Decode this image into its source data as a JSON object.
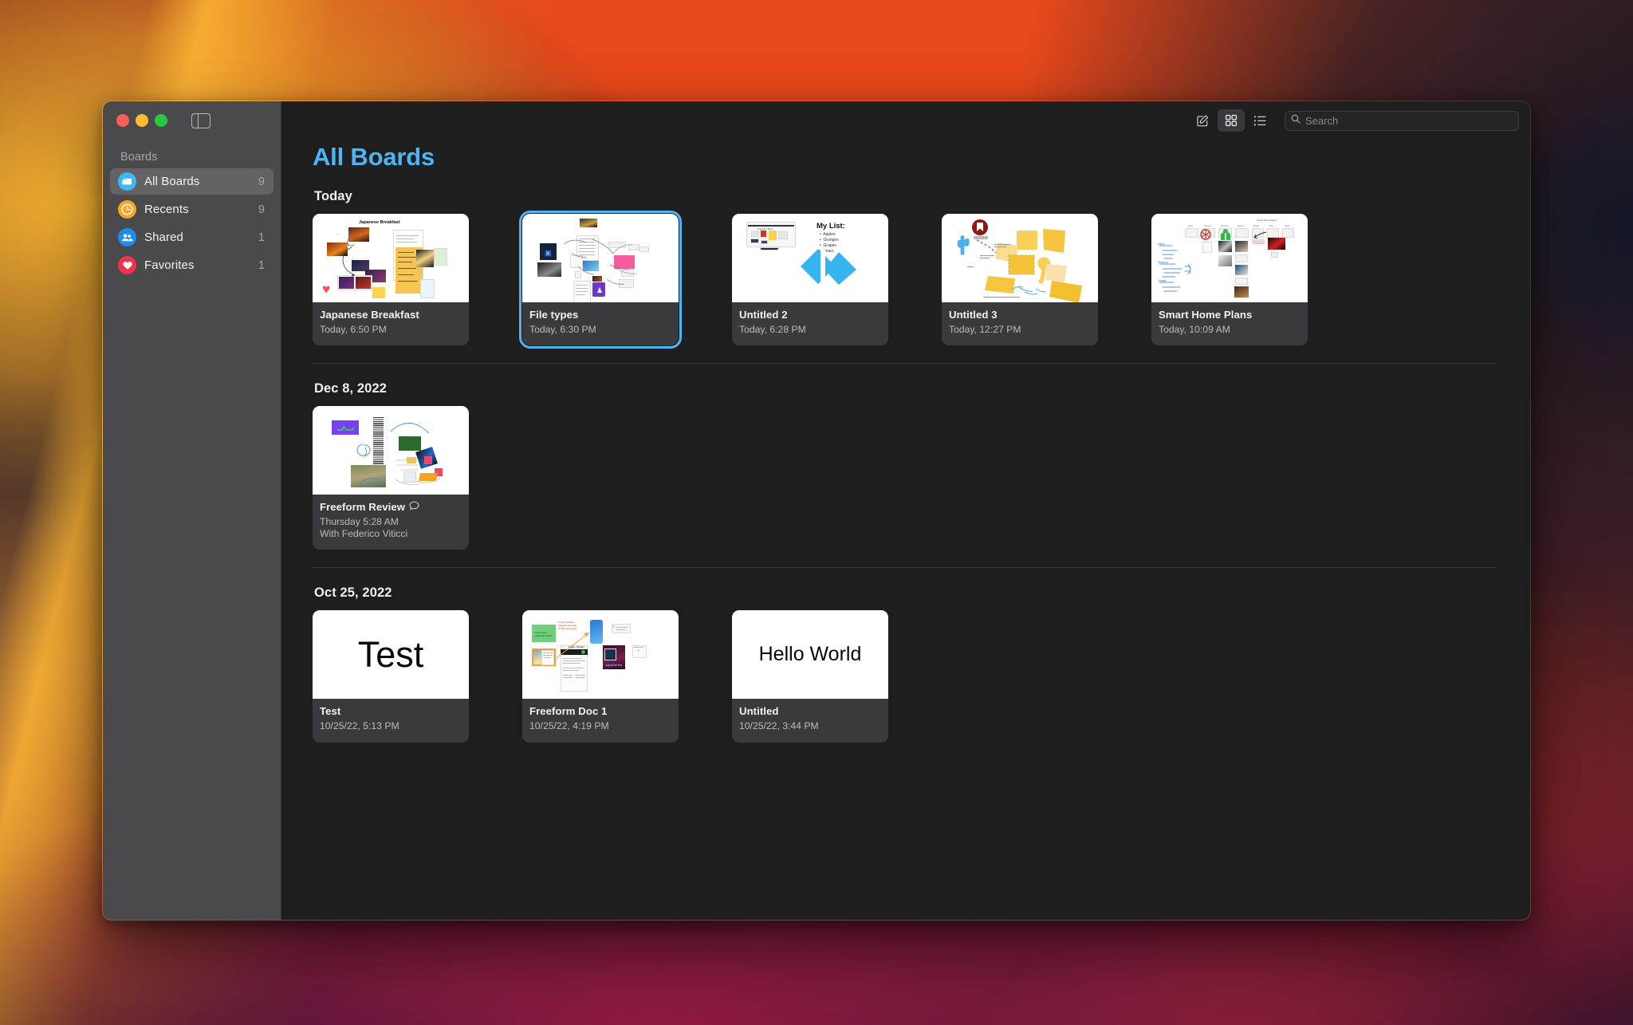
{
  "window": {
    "traffic_lights": [
      "close",
      "minimize",
      "zoom"
    ],
    "sidebar_toggle_icon": "sidebar-toggle-icon"
  },
  "sidebar": {
    "header": "Boards",
    "items": [
      {
        "label": "All Boards",
        "count": "9",
        "icon": "all-boards-icon",
        "color": "#3bb9f0",
        "selected": true
      },
      {
        "label": "Recents",
        "count": "9",
        "icon": "clock-icon",
        "color": "#f5a623",
        "selected": false
      },
      {
        "label": "Shared",
        "count": "1",
        "icon": "people-icon",
        "color": "#1d8ef0",
        "selected": false
      },
      {
        "label": "Favorites",
        "count": "1",
        "icon": "heart-icon",
        "color": "#f4314a",
        "selected": false
      }
    ]
  },
  "toolbar": {
    "new_board_label": "new-board",
    "grid_view_label": "grid-view",
    "list_view_label": "list-view",
    "search_placeholder": "Search",
    "search_value": "",
    "active_view": "grid"
  },
  "main": {
    "title": "All Boards",
    "accent_color": "#4db5f5",
    "selection_color": "#4db5f5",
    "sections": [
      {
        "heading": "Today",
        "boards": [
          {
            "title": "Japanese Breakfast",
            "subtitle": "Today, 6:50 PM",
            "subtitle2": "",
            "favorite": true,
            "selected": false,
            "shared": false,
            "thumb": "japanese-breakfast"
          },
          {
            "title": "File types",
            "subtitle": "Today, 6:30 PM",
            "subtitle2": "",
            "favorite": false,
            "selected": true,
            "shared": false,
            "thumb": "file-types"
          },
          {
            "title": "Untitled 2",
            "subtitle": "Today, 6:28 PM",
            "subtitle2": "",
            "favorite": false,
            "selected": false,
            "shared": false,
            "thumb": "untitled-2"
          },
          {
            "title": "Untitled 3",
            "subtitle": "Today, 12:27 PM",
            "subtitle2": "",
            "favorite": false,
            "selected": false,
            "shared": false,
            "thumb": "untitled-3"
          },
          {
            "title": "Smart Home Plans",
            "subtitle": "Today, 10:09 AM",
            "subtitle2": "",
            "favorite": false,
            "selected": false,
            "shared": false,
            "thumb": "smart-home-plans"
          }
        ]
      },
      {
        "heading": "Dec 8, 2022",
        "boards": [
          {
            "title": "Freeform Review",
            "subtitle": "Thursday 5:28 AM",
            "subtitle2": "With Federico Viticci",
            "favorite": false,
            "selected": false,
            "shared": true,
            "thumb": "freeform-review"
          }
        ]
      },
      {
        "heading": "Oct 25, 2022",
        "boards": [
          {
            "title": "Test",
            "subtitle": "10/25/22, 5:13 PM",
            "subtitle2": "",
            "favorite": false,
            "selected": false,
            "shared": false,
            "thumb": "test"
          },
          {
            "title": "Freeform Doc 1",
            "subtitle": "10/25/22, 4:19 PM",
            "subtitle2": "",
            "favorite": false,
            "selected": false,
            "shared": false,
            "thumb": "freeform-doc-1"
          },
          {
            "title": "Untitled",
            "subtitle": "10/25/22, 3:44 PM",
            "subtitle2": "",
            "favorite": false,
            "selected": false,
            "shared": false,
            "thumb": "hello-world"
          }
        ]
      }
    ]
  },
  "thumbnails": {
    "japanese-breakfast": {
      "caption": "Japanese Breakfast"
    },
    "untitled-2": {
      "list_title": "My List:",
      "list_items": [
        "Apples",
        "Oranges",
        "Grapes",
        "Pears"
      ]
    },
    "test": {
      "word": "Test"
    },
    "hello-world": {
      "word": "Hello World"
    }
  }
}
